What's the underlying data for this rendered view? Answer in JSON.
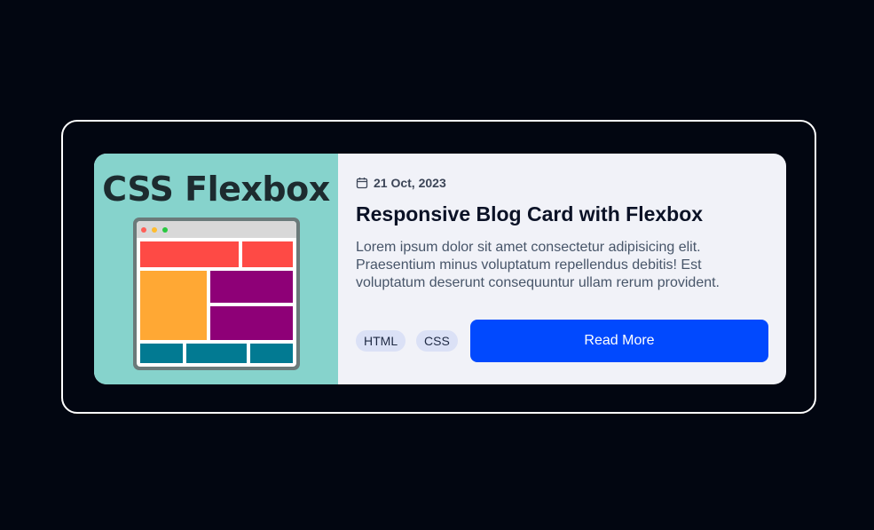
{
  "thumbnail": {
    "title": "CSS Flexbox",
    "colors": {
      "background": "#86d3cc",
      "header_red": "#fe4a45",
      "sidebar_orange": "#ffa834",
      "panel_purple": "#8e0077",
      "footer_teal": "#027a92"
    }
  },
  "post": {
    "date": "21 Oct, 2023",
    "title": "Responsive Blog Card with Flexbox",
    "description": "Lorem ipsum dolor sit amet consectetur adipisicing elit. Praesentium minus voluptatum repellendus debitis! Est voluptatum deserunt consequuntur ullam rerum provident."
  },
  "tags": [
    "HTML",
    "CSS"
  ],
  "actions": {
    "read_more_label": "Read More"
  },
  "icons": {
    "date": "calendar-icon"
  },
  "colors": {
    "page_background": "#020611",
    "card_background": "#f1f2f8",
    "accent": "#0149fe",
    "tag_background": "#dbe1f6"
  }
}
